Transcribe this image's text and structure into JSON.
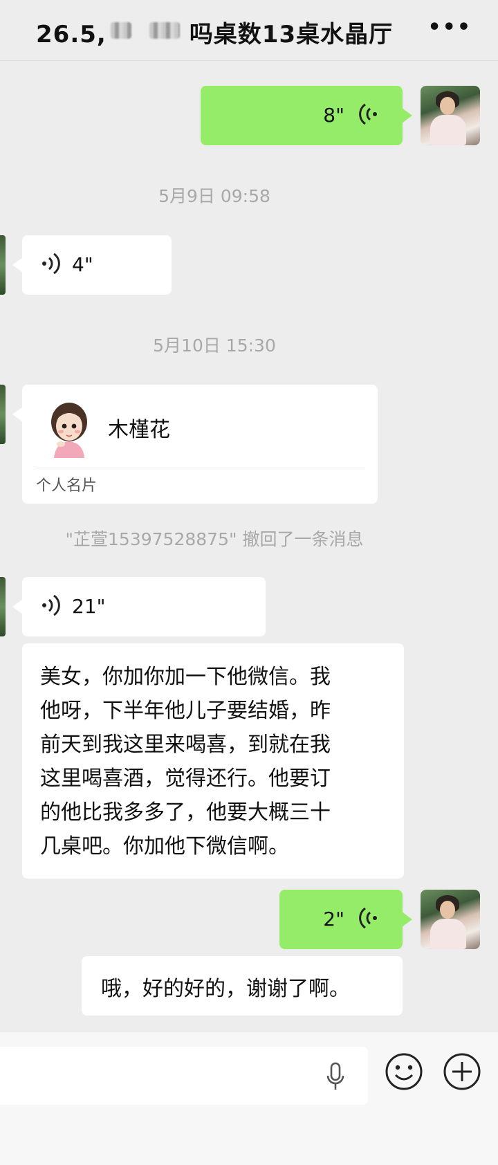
{
  "header": {
    "title_prefix": "26.5,",
    "title_suffix": "吗桌数13桌水晶厅",
    "more_label": "•••"
  },
  "messages": {
    "voice_out_1": {
      "duration": "8\""
    },
    "timestamp_1": "5月9日 09:58",
    "voice_in_1": {
      "duration": "4\""
    },
    "timestamp_2": "5月10日 15:30",
    "contact_card": {
      "name": "木槿花",
      "label": "个人名片"
    },
    "recall_notice": "\"芷萱15397528875\" 撤回了一条消息",
    "voice_in_2": {
      "duration": "21\""
    },
    "text_in_1": {
      "lines": [
        "美女，你加你加一下他微信。我",
        "他呀，下半年他儿子要结婚，昨",
        "前天到我这里来喝喜，到就在我",
        "这里喝喜酒，觉得还行。他要订",
        "的他比我多多了，他要大概三十",
        "几桌吧。你加他下微信啊。"
      ]
    },
    "voice_out_2": {
      "duration": "2\""
    },
    "text_out_1": "哦，好的好的，谢谢了啊。"
  },
  "icons": {
    "voice": "voice-wave-icon",
    "mic": "microphone-icon",
    "emoji": "emoji-icon",
    "plus": "plus-icon",
    "more": "more-icon"
  },
  "colors": {
    "outgoing_bubble": "#95ec69",
    "incoming_bubble": "#ffffff",
    "background": "#ededed"
  }
}
